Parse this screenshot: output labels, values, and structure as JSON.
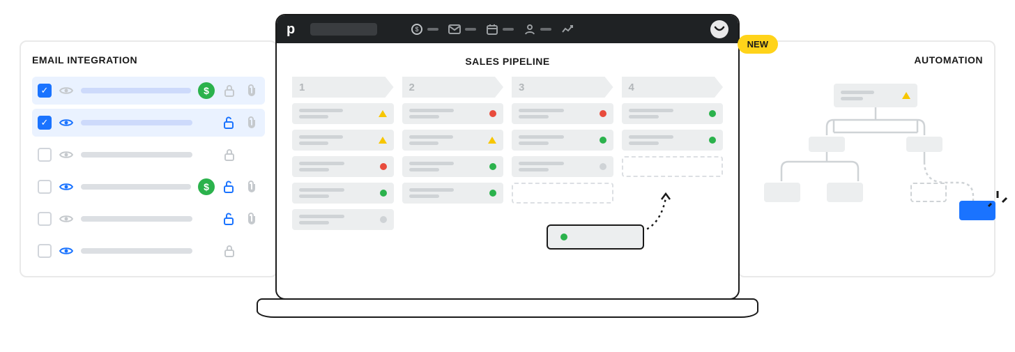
{
  "panels": {
    "email_integration": {
      "title": "EMAIL INTEGRATION",
      "rows": [
        {
          "checked": true,
          "eye": "grey",
          "money": true,
          "lock": "closed-grey",
          "clip": true
        },
        {
          "checked": true,
          "eye": "blue",
          "money": false,
          "lock": "open-blue",
          "clip": true
        },
        {
          "checked": false,
          "eye": "grey",
          "money": false,
          "lock": "closed-grey",
          "clip": false
        },
        {
          "checked": false,
          "eye": "blue",
          "money": true,
          "lock": "open-blue",
          "clip": true
        },
        {
          "checked": false,
          "eye": "grey",
          "money": false,
          "lock": "open-blue",
          "clip": true
        },
        {
          "checked": false,
          "eye": "blue",
          "money": false,
          "lock": "closed-grey",
          "clip": false
        }
      ]
    },
    "automation": {
      "title": "AUTOMATION"
    }
  },
  "new_badge": "NEW",
  "app": {
    "brand_initial": "p",
    "window_title": "SALES PIPELINE",
    "nav_icons": [
      "dollar-icon",
      "mail-icon",
      "calendar-icon",
      "contacts-icon",
      "trend-icon"
    ],
    "pipeline": {
      "stages": [
        {
          "label": "1",
          "cards": [
            {
              "status": "triangle"
            },
            {
              "status": "triangle"
            },
            {
              "status": "red"
            },
            {
              "status": "green"
            },
            {
              "status": "grey"
            }
          ]
        },
        {
          "label": "2",
          "cards": [
            {
              "status": "red"
            },
            {
              "status": "triangle"
            },
            {
              "status": "green"
            },
            {
              "status": "green"
            }
          ]
        },
        {
          "label": "3",
          "cards": [
            {
              "status": "red"
            },
            {
              "status": "green"
            },
            {
              "status": "grey"
            },
            {
              "status": "slot"
            }
          ]
        },
        {
          "label": "4",
          "cards": [
            {
              "status": "green"
            },
            {
              "status": "green"
            },
            {
              "status": "slot"
            }
          ]
        }
      ],
      "dragging_card": {
        "status": "green"
      }
    }
  },
  "colors": {
    "accent_blue": "#1a73ff",
    "accent_green": "#2bb24c",
    "accent_red": "#e84b3c",
    "accent_yellow": "#f7c600",
    "badge_yellow": "#ffd31a",
    "panel_border": "#e9e9e9",
    "neutral": "#eceeef"
  }
}
